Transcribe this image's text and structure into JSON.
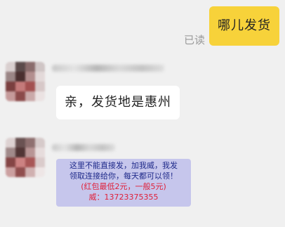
{
  "conversation": {
    "outgoing": {
      "text": "哪儿发货",
      "read_status": "已读"
    },
    "incoming": [
      {
        "text": "亲，发货地是惠州"
      },
      {
        "card_lines": [
          "这里不能直接发，加我威，我发",
          "领取连接给你，每天都可以领！",
          "(红包最低2元，一般5元)",
          "威：13723375355"
        ]
      }
    ]
  },
  "colors": {
    "background": "#f0f0f0",
    "outgoing_bubble": "#f7d23a",
    "incoming_bubble": "#ffffff",
    "card_bg": "#c6c6ec",
    "card_text_blue": "#1f2a8a",
    "card_text_red": "#e0203a"
  }
}
